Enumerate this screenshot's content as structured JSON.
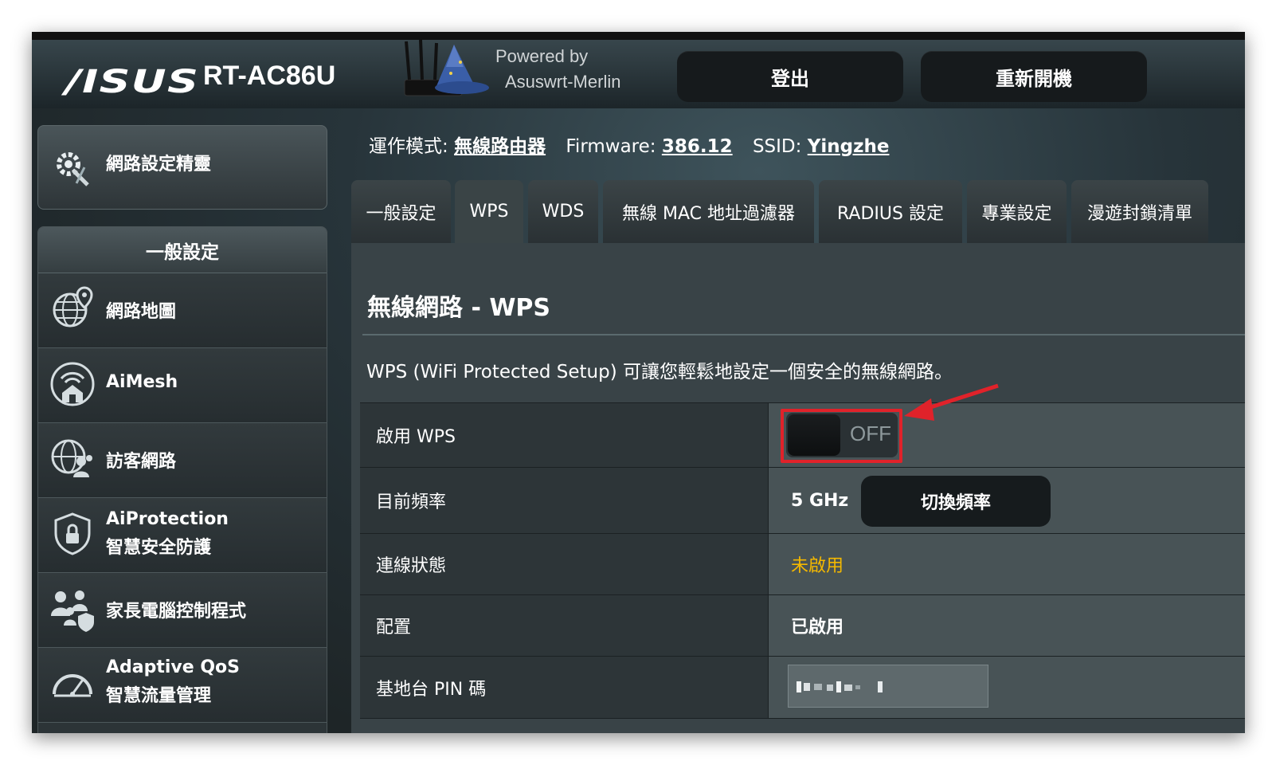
{
  "header": {
    "brand": "/ISUS",
    "model": "RT-AC86U",
    "powered_line1": "Powered by",
    "powered_line2": "Asuswrt-Merlin",
    "logout_label": "登出",
    "reboot_label": "重新開機"
  },
  "sidebar": {
    "wizard_label": "網路設定精靈",
    "group_title": "一般設定",
    "items": [
      {
        "label": "網路地圖",
        "icon": "globe-pin-icon"
      },
      {
        "label": "AiMesh",
        "icon": "aimesh-icon"
      },
      {
        "label": "訪客網路",
        "icon": "guest-network-icon"
      },
      {
        "label": "AiProtection",
        "sublabel": "智慧安全防護",
        "icon": "shield-lock-icon"
      },
      {
        "label": "家長電腦控制程式",
        "icon": "parental-control-icon"
      },
      {
        "label": "Adaptive QoS",
        "sublabel": "智慧流量管理",
        "icon": "speedometer-icon"
      }
    ]
  },
  "info": {
    "mode_label": "運作模式:",
    "mode_value": "無線路由器",
    "firmware_label": "Firmware:",
    "firmware_value": "386.12",
    "ssid_label": "SSID:",
    "ssid_value": "Yingzhe"
  },
  "tabs": [
    {
      "label": "一般設定"
    },
    {
      "label": "WPS"
    },
    {
      "label": "WDS"
    },
    {
      "label": "無線 MAC 地址過濾器"
    },
    {
      "label": "RADIUS 設定"
    },
    {
      "label": "專業設定"
    },
    {
      "label": "漫遊封鎖清單"
    }
  ],
  "panel": {
    "title": "無線網路 - WPS",
    "description": "WPS (WiFi Protected Setup) 可讓您輕鬆地設定一個安全的無線網路。",
    "rows": {
      "enable_wps": {
        "label": "啟用 WPS",
        "toggle_state": "OFF"
      },
      "current_band": {
        "label": "目前頻率",
        "value": "5 GHz",
        "button_label": "切換頻率"
      },
      "connection_status": {
        "label": "連線狀態",
        "value": "未啟用"
      },
      "configuration": {
        "label": "配置",
        "value": "已啟用"
      },
      "ap_pin": {
        "label": "基地台 PIN 碼"
      }
    }
  },
  "colors": {
    "status_warning": "#f4b800",
    "highlight_red": "#e0222a"
  }
}
